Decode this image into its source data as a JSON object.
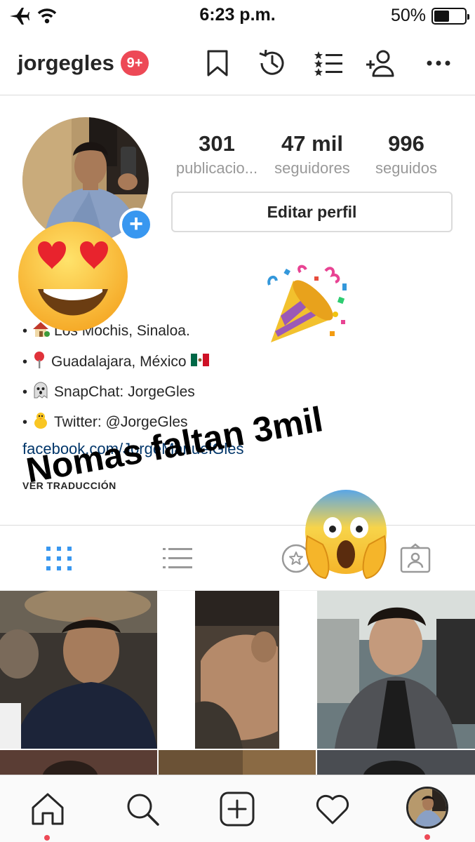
{
  "status_bar": {
    "time": "6:23 p.m.",
    "battery_text": "50%",
    "battery_level": 0.5,
    "icons": [
      "airplane-icon",
      "wifi-icon",
      "battery-icon"
    ]
  },
  "header": {
    "username": "jorgegles",
    "notification_badge": "9+",
    "actions": [
      "bookmark-icon",
      "archive-history-icon",
      "close-friends-list-icon",
      "discover-people-icon",
      "more-options-icon"
    ]
  },
  "profile": {
    "stats": [
      {
        "number": "301",
        "label": "publicacio..."
      },
      {
        "number": "47 mil",
        "label": "seguidores"
      },
      {
        "number": "996",
        "label": "seguidos"
      }
    ],
    "edit_button": "Editar perfil",
    "bio": [
      {
        "icon": "house-emoji",
        "text": "Los Mochis, Sinaloa."
      },
      {
        "icon": "pin-emoji",
        "text": "Guadalajara, México",
        "flag": "mexico-flag-emoji"
      },
      {
        "icon": "ghost-emoji",
        "text": "SnapChat: JorgeGles"
      },
      {
        "icon": "chick-emoji",
        "text": "Twitter: @JorgeGles"
      }
    ],
    "link": "facebook.com/JorgeManuelGles",
    "see_translation": "VER TRADUCCIÓN"
  },
  "overlay": {
    "caption": "Nomas faltan 3mil",
    "stickers": [
      "heart-eyes-emoji",
      "party-popper-emoji",
      "screaming-face-emoji"
    ]
  },
  "profile_tabs": [
    "grid-view-icon",
    "list-view-icon",
    "saved-star-icon",
    "tagged-photos-icon"
  ],
  "bottom_nav": [
    "home-icon",
    "search-icon",
    "new-post-icon",
    "activity-heart-icon",
    "profile-avatar"
  ],
  "colors": {
    "accent_blue": "#3897f0",
    "badge_red": "#ed4956",
    "link_blue": "#003569",
    "muted_gray": "#999999",
    "border": "#dbdbdb"
  }
}
